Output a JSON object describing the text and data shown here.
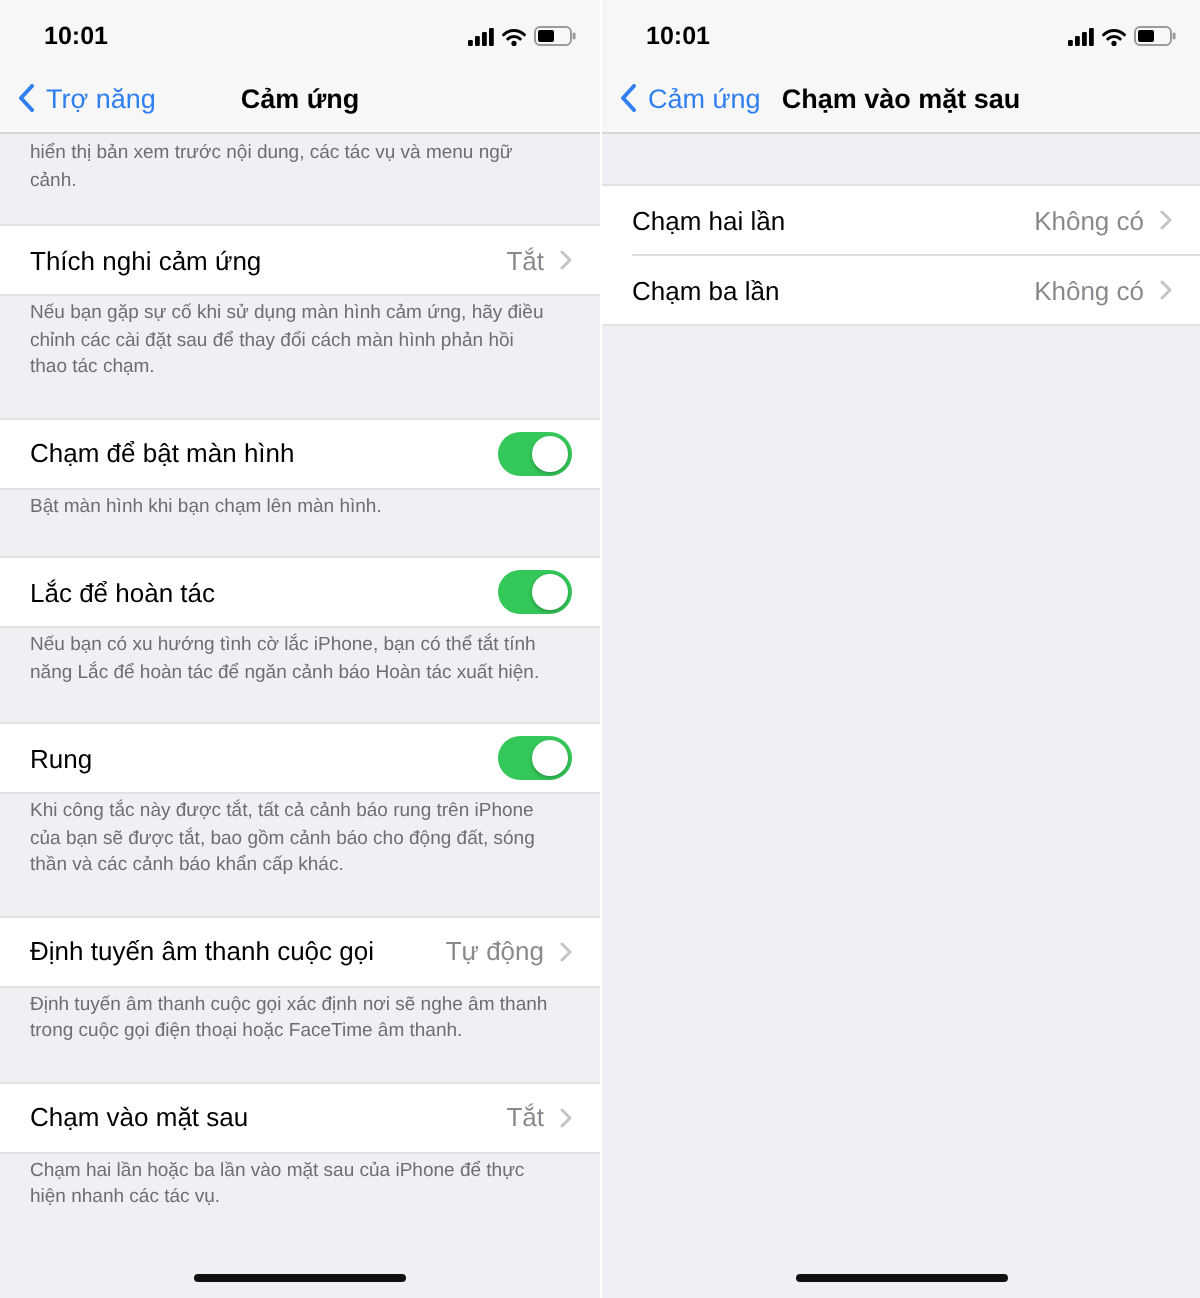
{
  "screens": [
    {
      "status_bar": {
        "time": "10:01"
      },
      "nav": {
        "back": "Trợ năng",
        "title": "Cảm ứng"
      },
      "top_note": "hiển thị bản xem trước nội dung, các tác vụ và menu ngữ cảnh.",
      "sections": [
        {
          "rows": [
            {
              "kind": "value",
              "label": "Thích nghi cảm ứng",
              "value": "Tắt"
            }
          ],
          "footer": "Nếu bạn gặp sự cố khi sử dụng màn hình cảm ứng, hãy điều chỉnh các cài đặt sau để thay đổi cách màn hình phản hồi thao tác chạm."
        },
        {
          "rows": [
            {
              "kind": "toggle",
              "label": "Chạm để bật màn hình",
              "on": true
            }
          ],
          "footer": "Bật màn hình khi bạn chạm lên màn hình."
        },
        {
          "rows": [
            {
              "kind": "toggle",
              "label": "Lắc để hoàn tác",
              "on": true
            }
          ],
          "footer": "Nếu bạn có xu hướng tình cờ lắc iPhone, bạn có thể tắt tính năng Lắc để hoàn tác để ngăn cảnh báo Hoàn tác xuất hiện."
        },
        {
          "rows": [
            {
              "kind": "toggle",
              "label": "Rung",
              "on": true
            }
          ],
          "footer": "Khi công tắc này được tắt, tất cả cảnh báo rung trên iPhone của bạn sẽ được tắt, bao gồm cảnh báo cho động đất, sóng thần và các cảnh báo khẩn cấp khác."
        },
        {
          "rows": [
            {
              "kind": "value",
              "label": "Định tuyến âm thanh cuộc gọi",
              "value": "Tự động"
            }
          ],
          "footer": "Định tuyến âm thanh cuộc gọi xác định nơi sẽ nghe âm thanh trong cuộc gọi điện thoại hoặc FaceTime âm thanh."
        },
        {
          "rows": [
            {
              "kind": "value",
              "label": "Chạm vào mặt sau",
              "value": "Tắt"
            }
          ],
          "footer": "Chạm hai lần hoặc ba lần vào mặt sau của iPhone để thực hiện nhanh các tác vụ."
        }
      ]
    },
    {
      "status_bar": {
        "time": "10:01"
      },
      "nav": {
        "back": "Cảm ứng",
        "title": "Chạm vào mặt sau"
      },
      "sections": [
        {
          "rows": [
            {
              "kind": "value",
              "label": "Chạm hai lần",
              "value": "Không có"
            },
            {
              "kind": "value",
              "label": "Chạm ba lần",
              "value": "Không có"
            }
          ]
        }
      ]
    }
  ]
}
